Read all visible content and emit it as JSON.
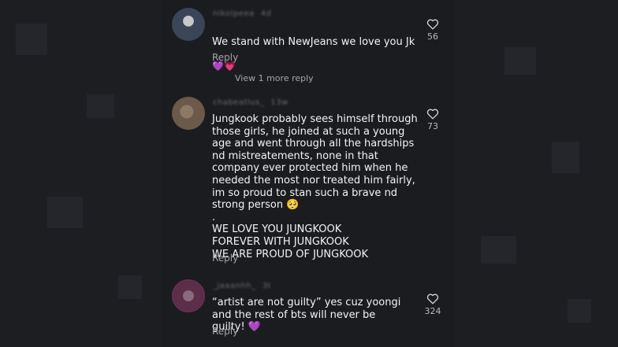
{
  "comments": [
    {
      "username": "nikolpeea",
      "time": "4d",
      "text": "We stand with NewJeans we love you Jk",
      "emoji": "💜💗",
      "reply_label": "Reply",
      "likes": "56",
      "avatar_color": "#3a4657"
    },
    {
      "username": "chabeatlus_",
      "time": "13w",
      "text": "Jungkook probably sees himself through those girls, he joined at such a young age and went through all the hardships nd mistreatements, none in that company ever protected him when he needed the most nor treated him fairly, im so proud to stan such a brave nd strong person 🥺\n.\nWE LOVE YOU JUNGKOOK\nFOREVER WITH JUNGKOOK\nWE ARE PROUD OF JUNGKOOK",
      "reply_label": "Reply",
      "likes": "73",
      "avatar_color": "#6b5a4a"
    },
    {
      "username": "_jaaanhh_",
      "time": "3t",
      "text": "“artist are not guilty” yes cuz yoongi and the rest of bts will never be guilty! 💜",
      "reply_label": "Reply",
      "likes": "324",
      "avatar_color": "#5a2f47"
    }
  ],
  "view_more_replies": "View 1 more reply",
  "colors": {
    "background": "#1d1e22",
    "text": "#f4f4f4",
    "muted": "#a5a6aa"
  }
}
